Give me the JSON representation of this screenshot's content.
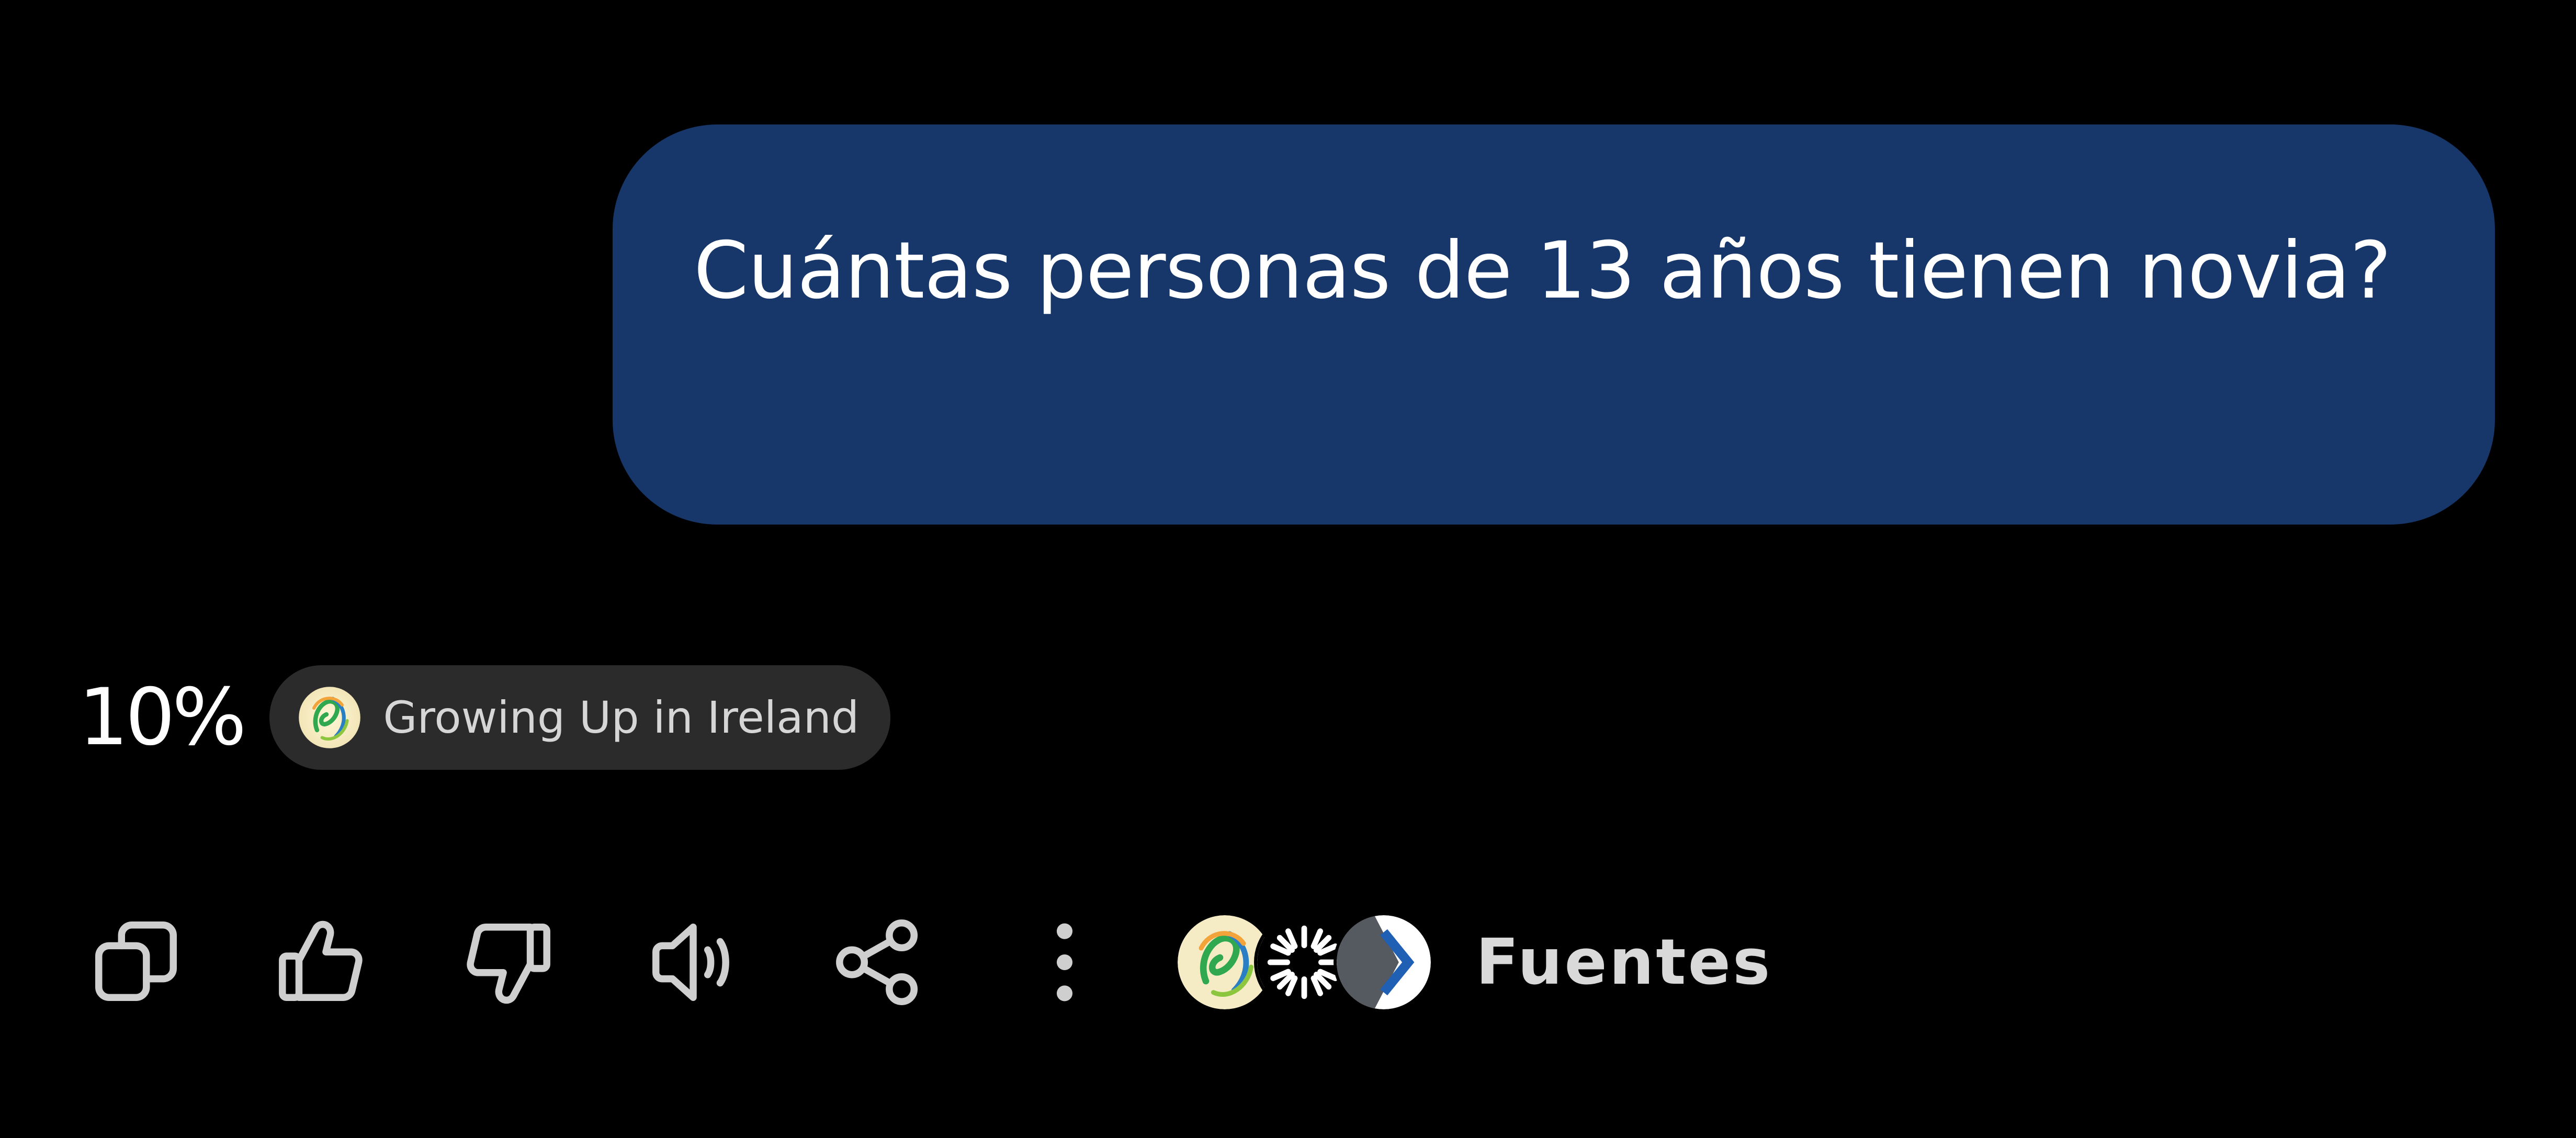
{
  "message": {
    "text": "Cuántas personas de 13 años tienen novia?",
    "bubble_color": "#17366a"
  },
  "answer": {
    "value": "10%",
    "source_chip": {
      "label": "Growing Up in Ireland",
      "icon": "growing-up-in-ireland-logo"
    }
  },
  "toolbar": {
    "actions": [
      {
        "name": "copy",
        "icon": "copy-icon"
      },
      {
        "name": "thumbs-up",
        "icon": "thumbs-up-icon"
      },
      {
        "name": "thumbs-down",
        "icon": "thumbs-down-icon"
      },
      {
        "name": "read-aloud",
        "icon": "speaker-icon"
      },
      {
        "name": "share",
        "icon": "share-icon"
      },
      {
        "name": "more",
        "icon": "more-vertical-icon"
      }
    ],
    "sources": {
      "label": "Fuentes",
      "icons": [
        "growing-up-in-ireland-logo",
        "starburst-logo",
        "chevron-logo"
      ]
    }
  },
  "colors": {
    "background": "#000000",
    "chip_background": "#2b2b2b",
    "icon_color": "#cfcfcf"
  }
}
